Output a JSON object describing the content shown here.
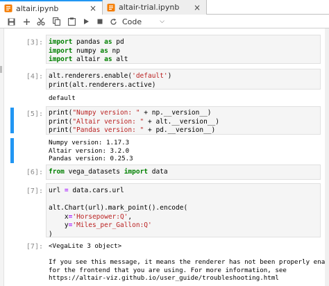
{
  "tabs": [
    {
      "label": "altair.ipynb",
      "close": "×"
    },
    {
      "label": "altair-trial.ipynb",
      "close": "×"
    }
  ],
  "toolbar": {
    "icons": [
      "save-icon",
      "add-icon",
      "cut-icon",
      "copy-icon",
      "paste-icon",
      "run-icon",
      "stop-icon",
      "restart-icon"
    ],
    "cell_type": "Code"
  },
  "colors": {
    "accent": "#2196f3",
    "keyword": "#008000",
    "string": "#ba2121",
    "prompt": "#8a8a8a"
  },
  "cells": [
    {
      "prompt": "[3]:",
      "code": [
        {
          "kw": "import",
          "rest": " pandas ",
          "kw2": "as",
          "rest2": " pd"
        },
        {
          "kw": "import",
          "rest": " numpy ",
          "kw2": "as",
          "rest2": " np"
        },
        {
          "kw": "import",
          "rest": " altair ",
          "kw2": "as",
          "rest2": " alt"
        }
      ]
    },
    {
      "prompt": "[4]:",
      "code": {
        "l1a": "alt.renderers.enable(",
        "l1s": "'default'",
        "l1b": ")",
        "l2": "print(alt.renderers.active)"
      },
      "output": "default"
    },
    {
      "prompt": "[5]:",
      "code": [
        {
          "a": "print(",
          "s": "\"Numpy version: \"",
          "b": " + np.__version__)"
        },
        {
          "a": "print(",
          "s": "\"Altair version: \"",
          "b": " + alt.__version__)"
        },
        {
          "a": "print(",
          "s": "\"Pandas version: \"",
          "b": " + pd.__version__)"
        }
      ],
      "output": [
        "Numpy version: 1.17.3",
        "Altair version: 3.2.0",
        "Pandas version: 0.25.3"
      ]
    },
    {
      "prompt": "[6]:",
      "code": {
        "kw": "from",
        "rest": " vega_datasets ",
        "kw2": "import",
        "rest2": " data"
      }
    },
    {
      "prompt": "[7]:",
      "code": {
        "l1a": "url ",
        "l1op": "=",
        "l1b": " data.cars.url",
        "l2": "alt.Chart(url).mark_point().encode(",
        "l3a": "    x",
        "l3op": "=",
        "l3s": "'Horsepower:Q'",
        "l3b": ",",
        "l4a": "    y",
        "l4op": "=",
        "l4s": "'Miles_per_Gallon:Q'",
        "l5": ")"
      }
    },
    {
      "prompt": "[7]:",
      "output": [
        "<VegaLite 3 object>",
        "",
        "If you see this message, it means the renderer has not been properly enabled",
        "for the frontend that you are using. For more information, see",
        "https://altair-viz.github.io/user_guide/troubleshooting.html"
      ]
    }
  ]
}
